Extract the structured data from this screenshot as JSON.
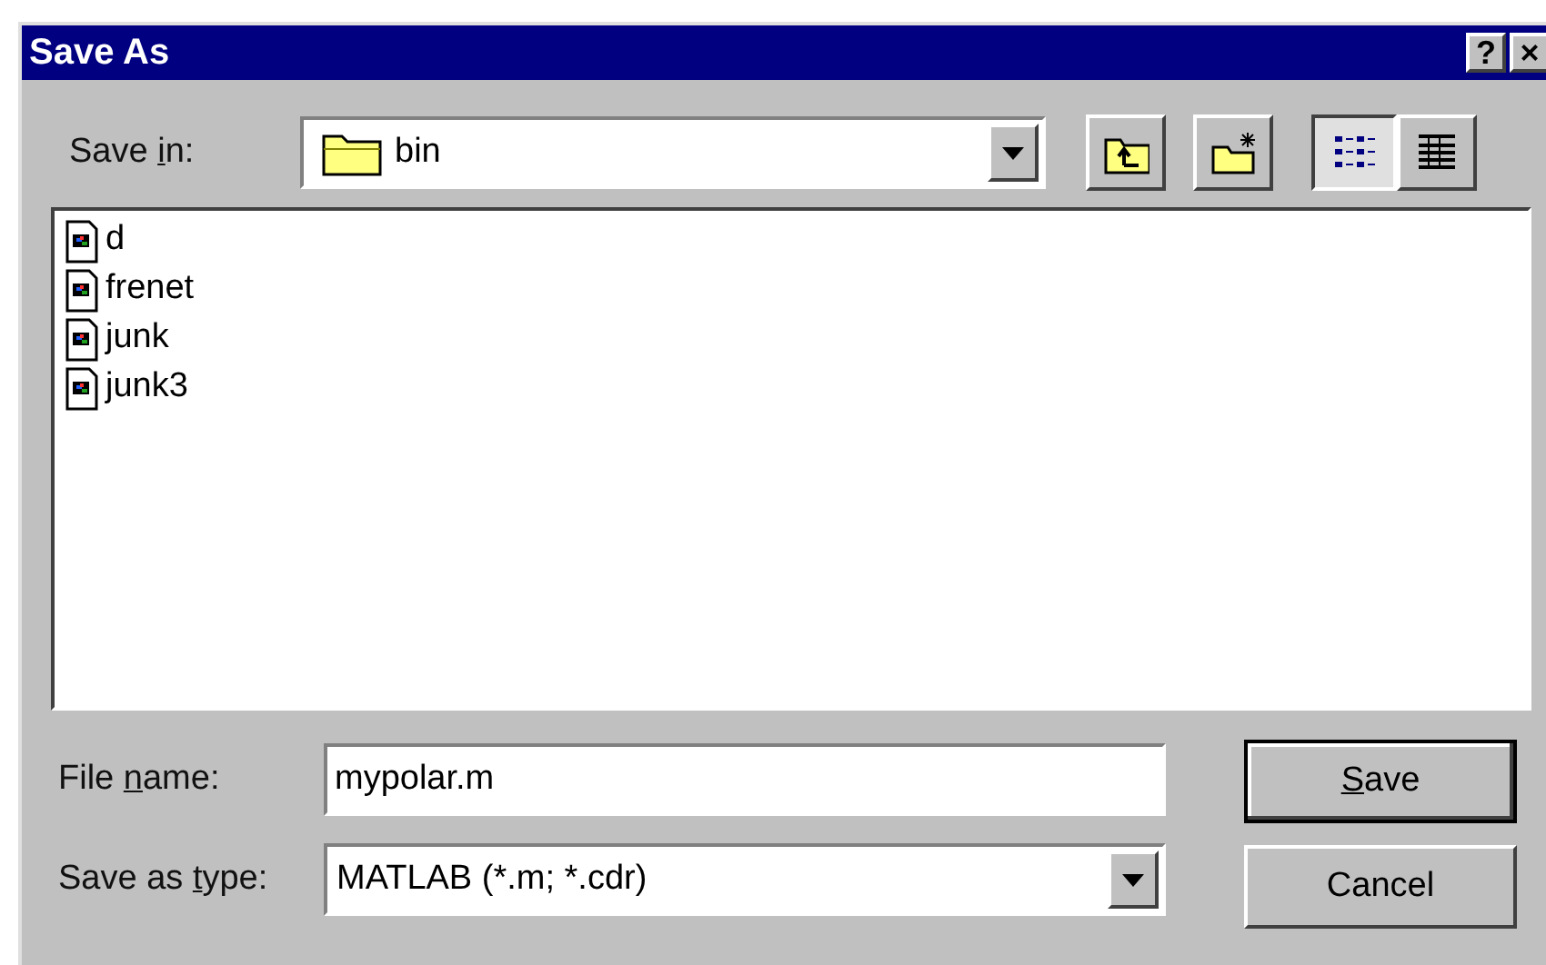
{
  "window": {
    "title": "Save As",
    "title_buttons": [
      "?",
      "×"
    ]
  },
  "save_in": {
    "label": {
      "before": "Save ",
      "mnemonic": "i",
      "after": "n:"
    },
    "value": "bin"
  },
  "toolbar": [
    {
      "kind": "up-folder",
      "pressed": false
    },
    {
      "kind": "new-folder",
      "pressed": false
    },
    {
      "kind": "list-view",
      "pressed": true
    },
    {
      "kind": "details-view",
      "pressed": false
    }
  ],
  "files": [
    {
      "name": "d"
    },
    {
      "name": "frenet"
    },
    {
      "name": "junk"
    },
    {
      "name": "junk3"
    }
  ],
  "file_name": {
    "label": {
      "before": "File ",
      "mnemonic": "n",
      "after": "ame:"
    },
    "value": "mypolar.m"
  },
  "save_as_type": {
    "label": {
      "before": "Save as ",
      "mnemonic": "t",
      "after": "ype:"
    },
    "value": "MATLAB (*.m; *.cdr)"
  },
  "buttons": [
    {
      "mnemonic": "S",
      "after": "ave",
      "default": true
    },
    {
      "before": "Cancel",
      "default": false
    }
  ]
}
